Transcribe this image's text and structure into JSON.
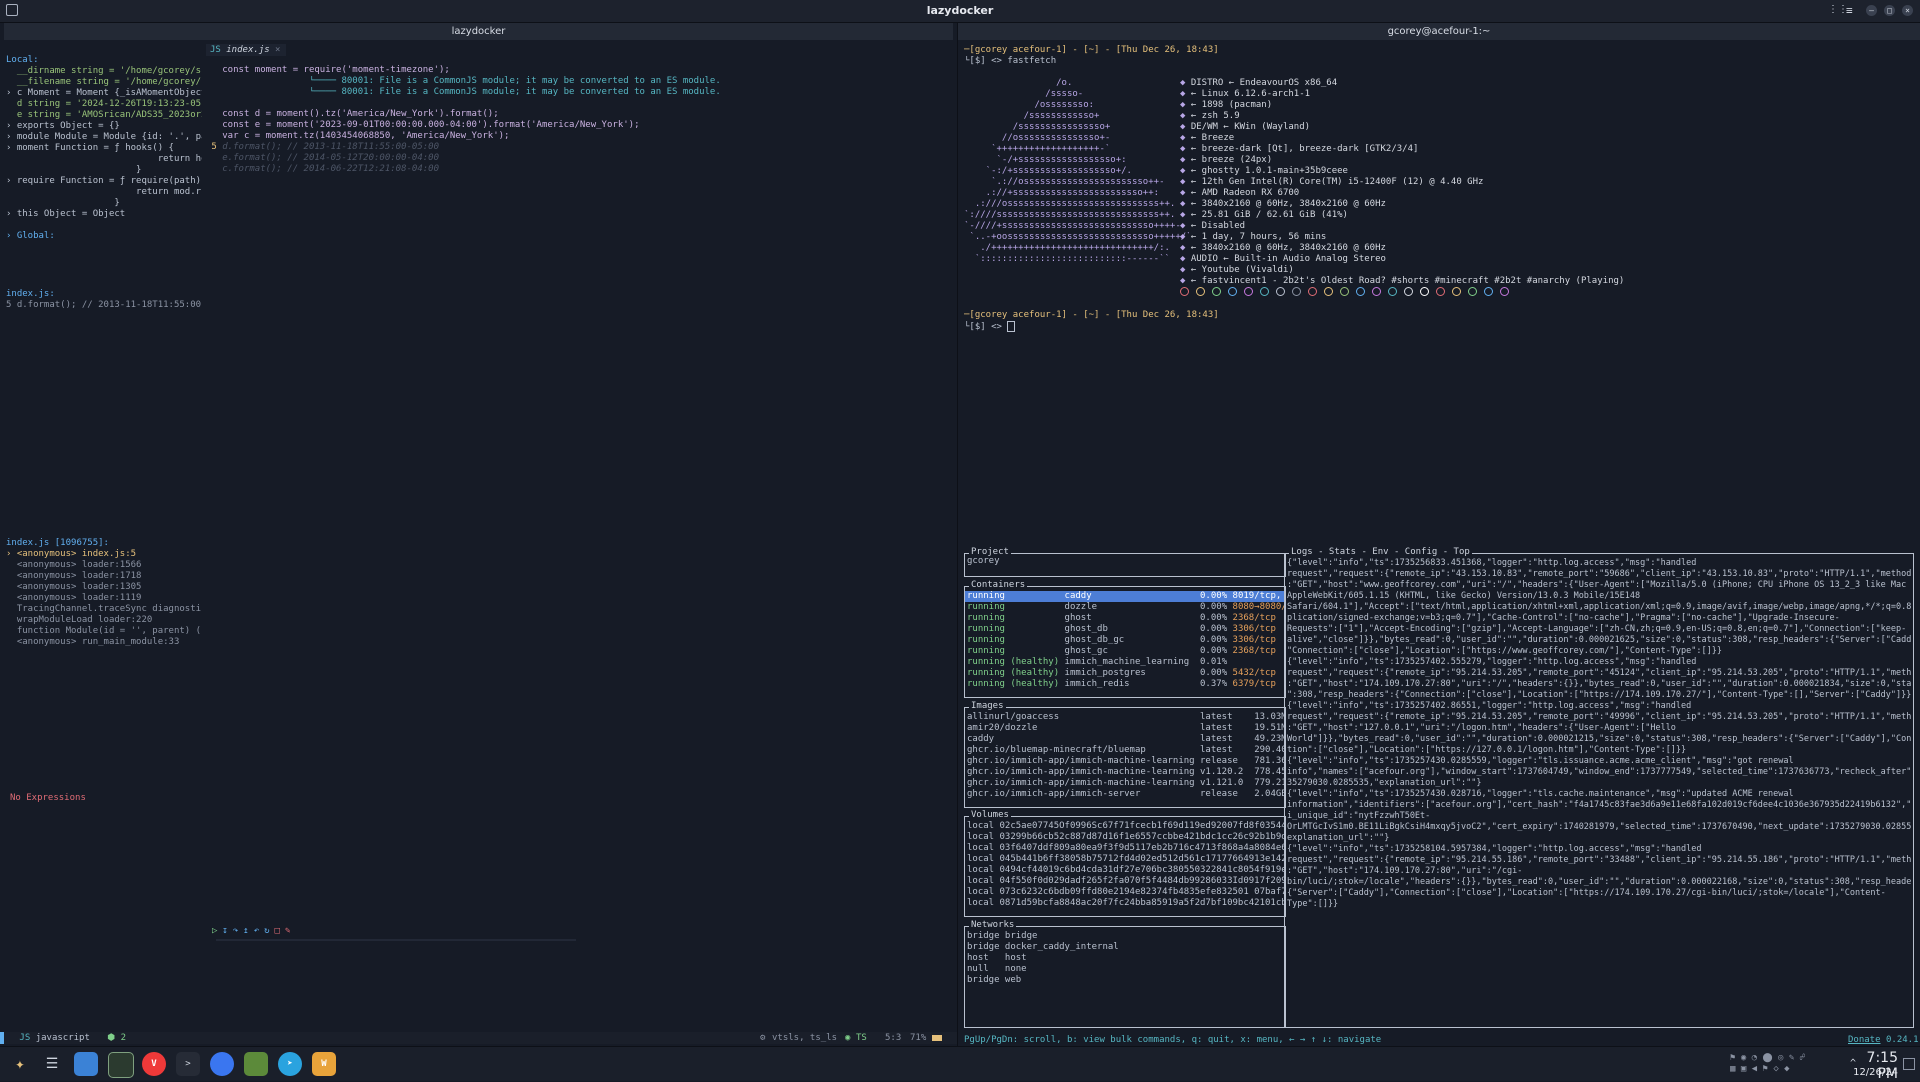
{
  "window": {
    "title": "lazydocker"
  },
  "left_panel": {
    "title": "lazydocker",
    "tab_file": "index.js",
    "variables": [
      "Local:",
      "  __dirname string = '/home/gcorey/sr",
      "  __filename string = '/home/gcorey/s",
      "› c Moment = Moment {_isAMomentObject",
      "  d string = '2024-12-26T19:13:23-05:",
      "  e string = 'AMOSrican/ADS35_2023or2",
      "› exports Object = {}",
      "› module Module = Module {id: '.', pa",
      "› moment Function = ƒ hooks() {",
      "                            return ho",
      "                        }",
      "› require Function = ƒ require(path)",
      "                        return mod.r",
      "                    }",
      "› this Object = Object",
      "",
      "› Global:"
    ],
    "watch_header": "index.js:",
    "watch_line": "5 d.format(); // 2013-11-18T11:55:00-",
    "stack_header": "index.js [1096755]:",
    "stack": [
      "› <anonymous> index.js:5",
      "  <anonymous> loader:1566",
      "  <anonymous> loader:1718",
      "  <anonymous> loader:1305",
      "  <anonymous> loader:1119",
      "  TracingChannel.traceSync diagnostics_",
      "  wrapModuleLoad loader:220",
      "  function Module(id = '', parent) (.ex",
      "  <anonymous> run_main_module:33"
    ],
    "no_expressions": "No Expressions",
    "code": [
      {
        "n": "",
        "t": "const moment = require('moment-timezone');"
      },
      {
        "n": "",
        "t": "                └──── 80001: File is a CommonJS module; it may be converted to an ES module."
      },
      {
        "n": "",
        "t": "                └──── 80001: File is a CommonJS module; it may be converted to an ES module."
      },
      {
        "n": "",
        "t": ""
      },
      {
        "n": "",
        "t": "const d = moment().tz('America/New_York').format();"
      },
      {
        "n": "",
        "t": "const e = moment('2023-09-01T00:00:00.000-04:00').format('America/New_York');"
      },
      {
        "n": "",
        "t": "var c = moment.tz(1403454068850, 'America/New_York');"
      },
      {
        "n": "5",
        "t": "d.format(); // 2013-11-18T11:55:00-05:00"
      },
      {
        "n": "",
        "t": "e.format(); // 2014-05-12T20:00:00-04:00"
      },
      {
        "n": "",
        "t": "c.format(); // 2014-06-22T12:21:08-04:00"
      }
    ],
    "status_lang": "javascript",
    "status_errors": "2",
    "status_lsp": "vtsls, ts_ls",
    "status_ts": "TS",
    "status_pos": "5:3",
    "status_pct": "71%"
  },
  "terminal": {
    "title": "gcorey@acefour-1:~",
    "prompt1": "─[gcorey acefour-1] - [~] - [Thu Dec 26, 18:43]",
    "cmd1": "└[$] <> fastfetch",
    "ascii": [
      "                 /o.",
      "               /sssso-",
      "             /ossssssso:",
      "           /ssssssssssso+",
      "         /ssssssssssssssso+",
      "       //osssssssssssssso+-",
      "     `+++++++++++++++++++-`",
      "      `-/+ssssssssssssssssso+:",
      "    `-:/+sssssssssssssssssso+/.",
      "     `.://osssssssssssssssssssssso++-",
      "    .://+ssssssssssssssssssssssso++:",
      "  .:///ossssssssssssssssssssssssssss++.",
      "`:////ssssssssssssssssssssssssssssss++.",
      "`-////+ssssssssssssssssssssssssssso++++-",
      " `..-+oosssssssssssssssssssssssssso+++++/`",
      "   ./++++++++++++++++++++++++++++++/:.",
      "  `:::::::::::::::::::::::::::------``"
    ],
    "info": [
      "DISTRO ← EndeavourOS x86_64",
      "← Linux 6.12.6-arch1-1",
      "← 1898 (pacman)",
      "← zsh 5.9",
      "DE/WM ← KWin (Wayland)",
      "← Breeze",
      "← breeze-dark [Qt], breeze-dark [GTK2/3/4]",
      "← breeze (24px)",
      "← ghostty 1.0.1-main+35b9ceee",
      "← 12th Gen Intel(R) Core(TM) i5-12400F (12) @ 4.40 GHz",
      "← AMD Radeon RX 6700",
      "← 3840x2160 @ 60Hz, 3840x2160 @ 60Hz",
      "← 25.81 GiB / 62.61 GiB (41%)",
      "← Disabled",
      "← 1 day, 7 hours, 56 mins",
      "← 3840x2160 @ 60Hz, 3840x2160 @ 60Hz",
      "AUDIO ← Built-in Audio Analog Stereo",
      "← Youtube (Vivaldi)",
      "← fastvincent1 - 2b2t's Oldest Road? #shorts #minecraft #2b2t #anarchy (Playing)"
    ],
    "prompt2": "─[gcorey acefour-1] - [~] - [Thu Dec 26, 18:43]",
    "cmd2": "└[$] <> "
  },
  "lazydocker": {
    "project_label": "Project",
    "project_name": "gcorey",
    "containers_label": "Containers",
    "containers": [
      {
        "status": "running",
        "name": "caddy",
        "cpu": "0.00%",
        "ports": "8019/tcp, 443"
      },
      {
        "status": "running",
        "name": "dozzle",
        "cpu": "0.00%",
        "ports": "8080→8080/tcp"
      },
      {
        "status": "running",
        "name": "ghost",
        "cpu": "0.00%",
        "ports": "2368/tcp"
      },
      {
        "status": "running",
        "name": "ghost_db",
        "cpu": "0.00%",
        "ports": "3306/tcp"
      },
      {
        "status": "running",
        "name": "ghost_db_gc",
        "cpu": "0.00%",
        "ports": "3306/tcp"
      },
      {
        "status": "running",
        "name": "ghost_gc",
        "cpu": "0.00%",
        "ports": "2368/tcp"
      },
      {
        "status": "running (healthy)",
        "name": "immich_machine_learning",
        "cpu": "0.01%",
        "ports": ""
      },
      {
        "status": "running (healthy)",
        "name": "immich_postgres",
        "cpu": "0.00%",
        "ports": "5432/tcp"
      },
      {
        "status": "running (healthy)",
        "name": "immich_redis",
        "cpu": "0.37%",
        "ports": "6379/tcp"
      }
    ],
    "images_label": "Images",
    "images": [
      {
        "name": "allinurl/goaccess",
        "tag": "latest",
        "size": "13.03MB"
      },
      {
        "name": "amir20/dozzle",
        "tag": "latest",
        "size": "19.51MB"
      },
      {
        "name": "caddy",
        "tag": "latest",
        "size": "49.23MB"
      },
      {
        "name": "ghcr.io/bluemap-minecraft/bluemap",
        "tag": "latest",
        "size": "290.40M"
      },
      {
        "name": "ghcr.io/immich-app/immich-machine-learning",
        "tag": "release",
        "size": "781.36M"
      },
      {
        "name": "ghcr.io/immich-app/immich-machine-learning",
        "tag": "v1.120.2",
        "size": "778.45M"
      },
      {
        "name": "ghcr.io/immich-app/immich-machine-learning",
        "tag": "v1.121.0",
        "size": "779.21M"
      },
      {
        "name": "ghcr.io/immich-app/immich-server",
        "tag": "release",
        "size": "2.04GB"
      }
    ],
    "volumes_label": "Volumes",
    "volumes": [
      "local 02c5ae07745Of0996Sc67f71fcecb1f69d119ed92007fd8f035442c73",
      "local 03299b66cb52c887d87d16f1e6557ccbbe421bdc1cc26c92b1b9d49a",
      "local 03f6407ddf809a80ea9f3f9d5117eb2b716c4713f868a4a8084e6b8b",
      "local 045b441b6ff38058b75712fd4d02ed512d561c17177664913e14296",
      "local 0494cf44019c6bd4cda31df27e706bc380550322841c8054f919e472",
      "local 04f550f0d029dadf265f2fa070f5f4484db99286033Id0917f209ed",
      "local 073c6232c6bdb09ffd80e2194e82374fb4835efe832501 07baf7e38c",
      "local 0871d59bcfa8848ac20f7fc24bba85919a5f2d7bf109bc42101cb73d"
    ],
    "networks_label": "Networks",
    "networks": [
      "bridge bridge",
      "bridge docker_caddy_internal",
      "host   host",
      "null   none",
      "bridge web"
    ],
    "logs_tabs": "Logs - Stats - Env - Config - Top",
    "logs": [
      "{\"level\":\"info\",\"ts\":1735256833.451368,\"logger\":\"http.log.access\",\"msg\":\"handled",
      "request\",\"request\":{\"remote_ip\":\"43.153.10.83\",\"remote_port\":\"59686\",\"client_ip\":\"43.153.10.83\",\"proto\":\"HTTP/1.1\",\"method\"",
      ":\"GET\",\"host\":\"www.geoffcorey.com\",\"uri\":\"/\",\"headers\":{\"User-Agent\":[\"Mozilla/5.0 (iPhone; CPU iPhone OS 13_2_3 like Mac OS X)",
      "AppleWebKit/605.1.15 (KHTML, like Gecko) Version/13.0.3 Mobile/15E148",
      "Safari/604.1\"],\"Accept\":[\"text/html,application/xhtml+xml,application/xml;q=0.9,image/avif,image/webp,image/apng,*/*;q=0.8,ap",
      "plication/signed-exchange;v=b3;q=0.7\"],\"Cache-Control\":[\"no-cache\"],\"Pragma\":[\"no-cache\"],\"Upgrade-Insecure-",
      "Requests\":[\"1\"],\"Accept-Encoding\":[\"gzip\"],\"Accept-Language\":[\"zh-CN,zh;q=0.9,en-US;q=0.8,en;q=0.7\"],\"Connection\":[\"keep-",
      "alive\",\"close\"]}},\"bytes_read\":0,\"user_id\":\"\",\"duration\":0.000021625,\"size\":0,\"status\":308,\"resp_headers\":{\"Server\":[\"Caddy\"]",
      "\"Connection\":[\"close\"],\"Location\":[\"https://www.geoffcorey.com/\"],\"Content-Type\":[]}}",
      "{\"level\":\"info\",\"ts\":1735257402.555279,\"logger\":\"http.log.access\",\"msg\":\"handled",
      "request\",\"request\":{\"remote_ip\":\"95.214.53.205\",\"remote_port\":\"45124\",\"client_ip\":\"95.214.53.205\",\"proto\":\"HTTP/1.1\",\"method\"",
      ":\"GET\",\"host\":\"174.109.170.27:80\",\"uri\":\"/\",\"headers\":{}},\"bytes_read\":0,\"user_id\":\"\",\"duration\":0.000021834,\"size\":0,\"status",
      "\":308,\"resp_headers\":{\"Connection\":[\"close\"],\"Location\":[\"https://174.109.170.27/\"],\"Content-Type\":[],\"Server\":[\"Caddy\"]}}",
      "{\"level\":\"info\",\"ts\":1735257402.86551,\"logger\":\"http.log.access\",\"msg\":\"handled",
      "request\",\"request\":{\"remote_ip\":\"95.214.53.205\",\"remote_port\":\"49996\",\"client_ip\":\"95.214.53.205\",\"proto\":\"HTTP/1.1\",\"method\"",
      ":\"GET\",\"host\":\"127.0.0.1\",\"uri\":\"/logon.htm\",\"headers\":{\"User-Agent\":[\"Hello",
      "World\"]}},\"bytes_read\":0,\"user_id\":\"\",\"duration\":0.000021215,\"size\":0,\"status\":308,\"resp_headers\":{\"Server\":[\"Caddy\"],\"Connec",
      "tion\":[\"close\"],\"Location\":[\"https://127.0.0.1/logon.htm\"],\"Content-Type\":[]}}",
      "{\"level\":\"info\",\"ts\":1735257430.0285559,\"logger\":\"tls.issuance.acme.acme_client\",\"msg\":\"got renewal",
      "info\",\"names\":[\"acefour.org\"],\"window_start\":1737604749,\"window_end\":1737777549,\"selected_time\":1737636773,\"recheck_after\":17",
      "35279030.0285535,\"explanation_url\":\"\"}",
      "{\"level\":\"info\",\"ts\":1735257430.028716,\"logger\":\"tls.cache.maintenance\",\"msg\":\"updated ACME renewal",
      "information\",\"identifiers\":[\"acefour.org\"],\"cert_hash\":\"f4a1745c83fae3d6a9e11e68fa102d019cf6dee4c1036e367935d22419b6132\",\"ar",
      "i_unique_id\":\"nytFzzwhT50Et-",
      "OrLMTGcIvS1m0.BE11LiBgkCsiH4mxqy5jvoC2\",\"cert_expiry\":1740281979,\"selected_time\":1737670490,\"next_update\":1735279030.0285535,",
      "explanation_url\":\"\"}",
      "{\"level\":\"info\",\"ts\":1735258104.5957384,\"logger\":\"http.log.access\",\"msg\":\"handled",
      "request\",\"request\":{\"remote_ip\":\"95.214.55.186\",\"remote_port\":\"33488\",\"client_ip\":\"95.214.55.186\",\"proto\":\"HTTP/1.1\",\"method\"",
      ":\"GET\",\"host\":\"174.109.170.27:80\",\"uri\":\"/cgi-",
      "bin/luci/;stok=/locale\",\"headers\":{}},\"bytes_read\":0,\"user_id\":\"\",\"duration\":0.000022168,\"size\":0,\"status\":308,\"resp_headers\"",
      "{\"Server\":[\"Caddy\"],\"Connection\":[\"close\"],\"Location\":[\"https://174.109.170.27/cgi-bin/luci/;stok=/locale\"],\"Content-",
      "Type\":[]}}"
    ],
    "footer_help": "PgUp/PgDn: scroll, b: view bulk commands, q: quit, x: menu, ← → ↑ ↓: navigate",
    "footer_donate": "Donate",
    "footer_version": "0.24.1"
  },
  "taskbar": {
    "time": "7:15 PM",
    "date": "12/26/24"
  },
  "colors": {
    "selected": "#4d7ed6",
    "running": "#7fcf8a",
    "accent": "#56b6c2"
  }
}
